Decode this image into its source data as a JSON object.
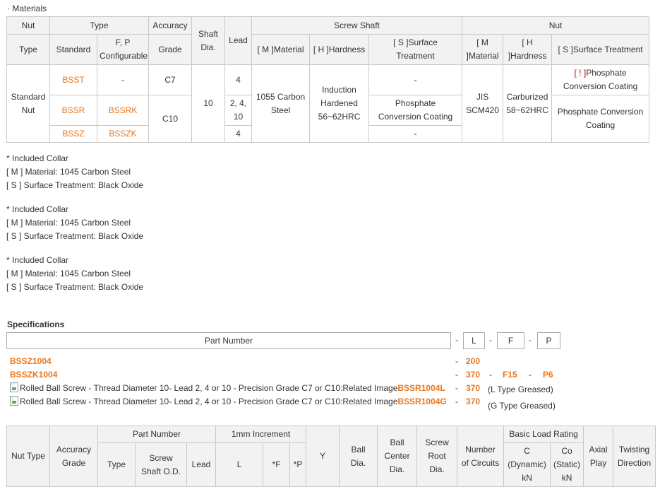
{
  "materials": {
    "title": "· Materials",
    "headers": {
      "nut": "Nut",
      "type": "Type",
      "accuracy": "Accuracy",
      "shaft": "Shaft",
      "lead": "Lead",
      "screw_shaft": "Screw Shaft",
      "nut_group": "Nut",
      "nut_type": "Type",
      "standard": "Standard",
      "fp_configurable": "F, P",
      "configurable": "Configurable",
      "grade": "Grade",
      "dia": "Dia.",
      "m_material": "[ M ]Material",
      "h_hardness": "[ H ]Hardness",
      "s_surface": "[ S ]Surface",
      "treatment": "Treatment",
      "nut_m_1": "[ M",
      "nut_m_2": "]Material",
      "nut_h_1": "[ H",
      "nut_h_2": "]Hardness",
      "nut_s": "[ S ]Surface Treatment"
    },
    "rows": {
      "nut_type_1": "Standard",
      "nut_type_2": "Nut",
      "bsst": "BSST",
      "bsst_fp": "-",
      "c7": "C7",
      "shaft_dia": "10",
      "lead_4a": "4",
      "m_material_1": "1055 Carbon",
      "m_material_2": "Steel",
      "h_hardness_1": "Induction",
      "h_hardness_2": "Hardened",
      "h_hardness_3": "56~62HRC",
      "s_surface_1": "-",
      "nut_material_1": "JIS",
      "nut_material_2": "SCM420",
      "nut_hardness_1": "Carburized",
      "nut_hardness_2": "58~62HRC",
      "nut_surface_1_mark": "[ ! ]",
      "nut_surface_1a": "Phosphate",
      "nut_surface_1b": "Conversion Coating",
      "bssr": "BSSR",
      "bssrk": "BSSRK",
      "c10": "C10",
      "lead_24": "2, 4,",
      "lead_10": "10",
      "s_surface_2a": "Phosphate",
      "s_surface_2b": "Conversion Coating",
      "nut_surface_2a": "Phosphate Conversion",
      "nut_surface_2b": "Coating",
      "bssz": "BSSZ",
      "bsszk": "BSSZK",
      "lead_4b": "4",
      "s_surface_3": "-"
    }
  },
  "notes": [
    {
      "collar": "* Included Collar",
      "material": "[ M ] Material: 1045 Carbon Steel",
      "surface": "[ S ] Surface Treatment: Black Oxide"
    },
    {
      "collar": "* Included Collar",
      "material": "[ M ] Material: 1045 Carbon Steel",
      "surface": "[ S ] Surface Treatment: Black Oxide"
    },
    {
      "collar": "* Included Collar",
      "material": "[ M ] Material: 1045 Carbon Steel",
      "surface": "[ S ] Surface Treatment: Black Oxide"
    }
  ],
  "specifications": {
    "title": "Specifications",
    "header": {
      "part_number": "Part Number",
      "l": "L",
      "f": "F",
      "p": "P",
      "dash": "-"
    },
    "rows": [
      {
        "image_alt": "",
        "part": "BSSZ1004",
        "dash1": "-",
        "l": "200",
        "dash2": "",
        "f": "",
        "dash3": "",
        "p": "",
        "note": ""
      },
      {
        "image_alt": "",
        "part": "BSSZK1004",
        "dash1": "-",
        "l": "370",
        "dash2": "-",
        "f": "F15",
        "dash3": "-",
        "p": "P6",
        "note": ""
      },
      {
        "image_alt": "Rolled Ball Screw - Thread Diameter 10- Lead 2, 4 or 10 - Precision Grade C7 or C10:Related Image",
        "part": "BSSR1004L",
        "dash1": "-",
        "l": "370",
        "dash2": "",
        "f": "",
        "dash3": "",
        "p": "",
        "note": "(L Type Greased)"
      },
      {
        "image_alt": "Rolled Ball Screw - Thread Diameter 10- Lead 2, 4 or 10 - Precision Grade C7 or C10:Related Image",
        "part": "BSSR1004G",
        "dash1": "-",
        "l": "370",
        "dash2": "",
        "f": "",
        "dash3": "",
        "p": "",
        "note": "(G Type Greased)"
      }
    ]
  },
  "spec_table": {
    "nut_type": "Nut Type",
    "accuracy_1": "Accuracy",
    "accuracy_2": "Grade",
    "part_number": "Part Number",
    "increment": "1mm Increment",
    "y": "Y",
    "ball_1": "Ball",
    "ball_2": "Dia.",
    "ball_center_1": "Ball",
    "ball_center_2": "Center",
    "ball_center_3": "Dia.",
    "screw_root_1": "Screw",
    "screw_root_2": "Root",
    "screw_root_3": "Dia.",
    "circuits_1": "Number",
    "circuits_2": "of Circuits",
    "basic_load": "Basic Load Rating",
    "axial_1": "Axial",
    "axial_2": "Play",
    "twisting_1": "Twisting",
    "twisting_2": "Direction",
    "type": "Type",
    "screw_od_1": "Screw",
    "screw_od_2": "Shaft O.D.",
    "lead": "Lead",
    "l": "L",
    "f": "*F",
    "p": "*P",
    "c_1": "C",
    "c_2": "(Dynamic)",
    "c_3": "kN",
    "co_1": "Co",
    "co_2": "(Static)",
    "co_3": "kN"
  }
}
